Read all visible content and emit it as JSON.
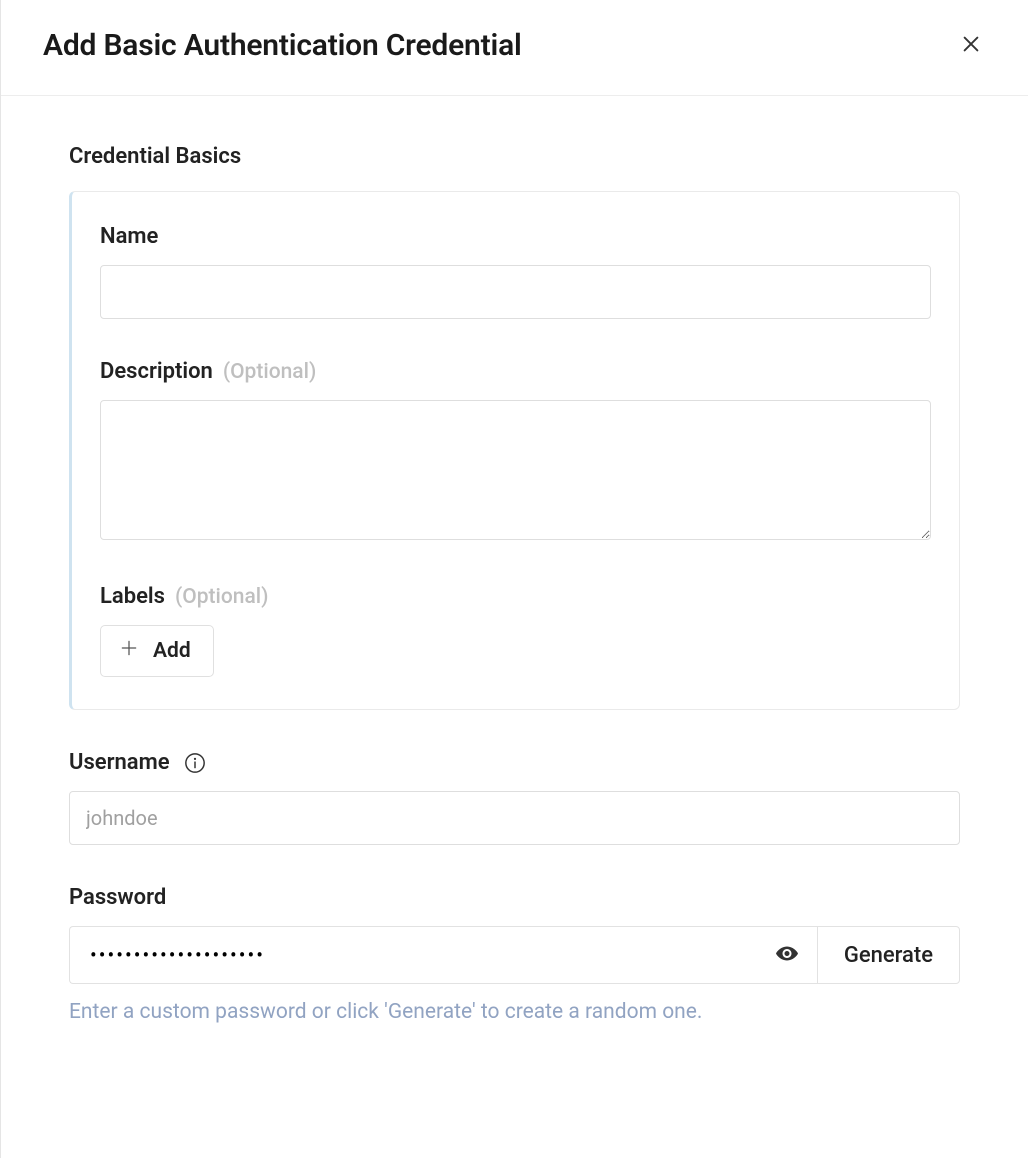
{
  "header": {
    "title": "Add Basic Authentication Credential"
  },
  "basics": {
    "section_title": "Credential Basics",
    "name_label": "Name",
    "name_value": "",
    "description_label": "Description",
    "description_optional": "(Optional)",
    "description_value": "",
    "labels_label": "Labels",
    "labels_optional": "(Optional)",
    "add_label_button": "Add"
  },
  "username": {
    "label": "Username",
    "placeholder": "johndoe",
    "value": ""
  },
  "password": {
    "label": "Password",
    "value": "••••••••••••••••••••",
    "generate_button": "Generate",
    "hint": "Enter a custom password or click 'Generate' to create a random one."
  }
}
